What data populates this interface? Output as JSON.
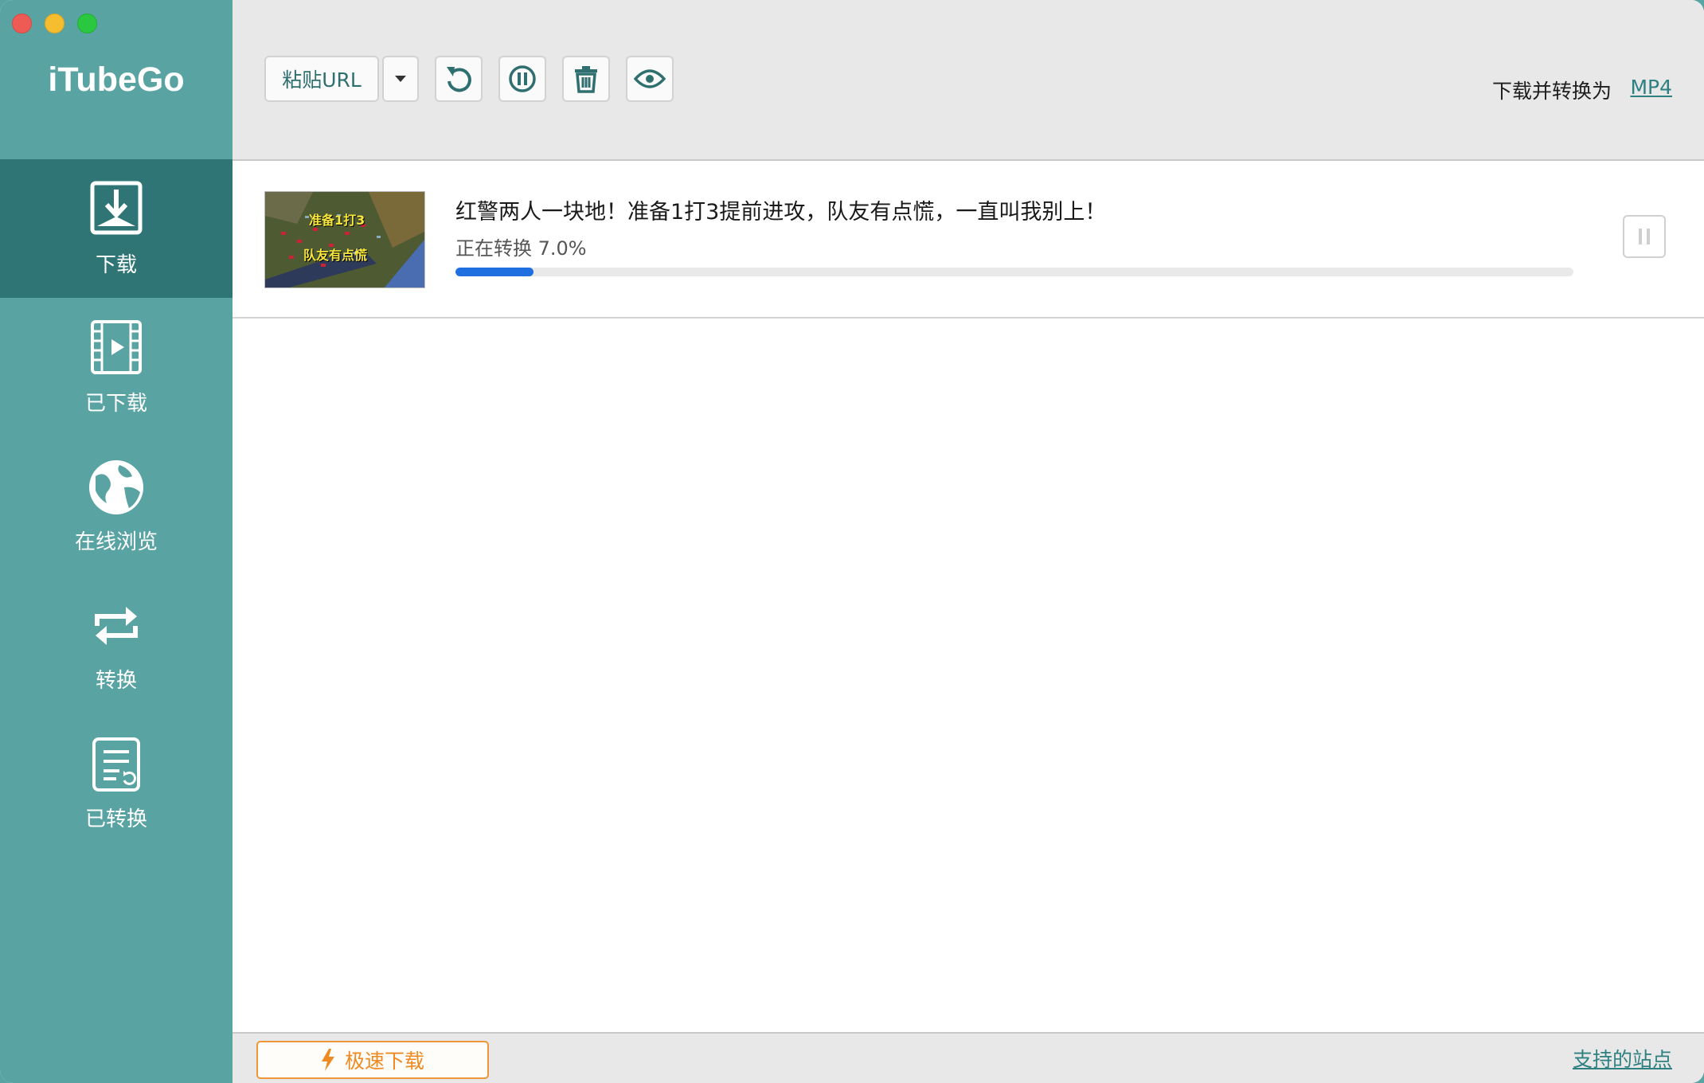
{
  "app": {
    "logo": "iTubeGo"
  },
  "sidebar": {
    "items": [
      {
        "label": "下载",
        "icon": "download-icon",
        "active": true
      },
      {
        "label": "已下载",
        "icon": "video-file-icon",
        "active": false
      },
      {
        "label": "在线浏览",
        "icon": "globe-icon",
        "active": false
      },
      {
        "label": "转换",
        "icon": "convert-icon",
        "active": false
      },
      {
        "label": "已转换",
        "icon": "converted-list-icon",
        "active": false
      }
    ]
  },
  "toolbar": {
    "paste_label": "粘贴URL",
    "icons": [
      "chevron-down-icon",
      "refresh-icon",
      "pause-all-icon",
      "trash-icon",
      "eye-icon"
    ],
    "format_label": "下载并转换为",
    "format_value": "MP4"
  },
  "downloads": [
    {
      "title": "红警两人一块地！准备1打3提前进攻，队友有点慌，一直叫我别上！",
      "status": "正在转换 7.0%",
      "progress": 0.07,
      "thumb_text_1": "准备1打3",
      "thumb_text_2": "队友有点慌"
    }
  ],
  "footer": {
    "turbo_label": "极速下载",
    "sites_label": "支持的站点"
  },
  "colors": {
    "sidebar": "#5aa3a3",
    "sidebar_active": "#2f7575",
    "accent": "#2f8080",
    "progress": "#1f6fe0",
    "turbo": "#ef8a22"
  }
}
